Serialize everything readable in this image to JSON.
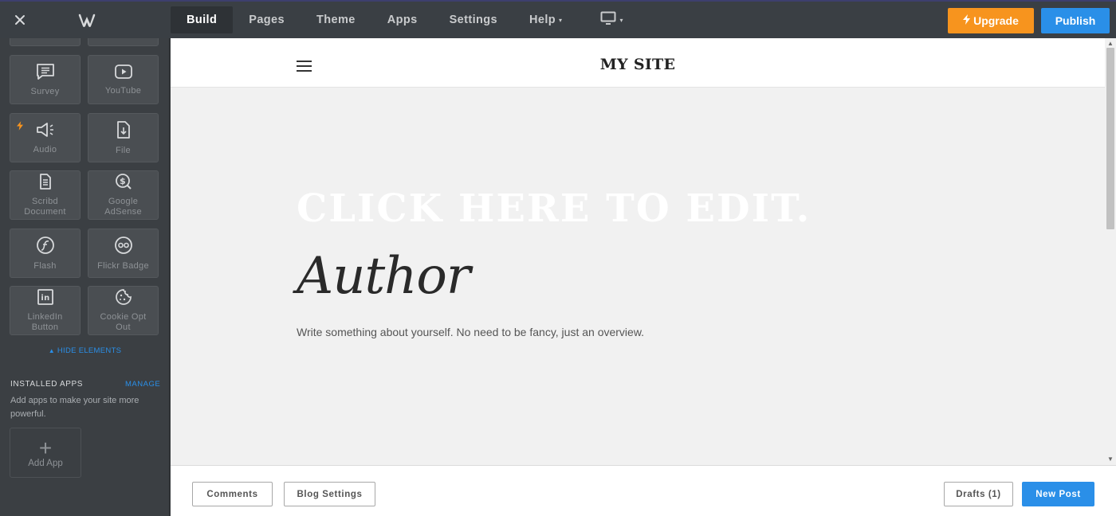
{
  "topbar": {
    "close_icon": "close-icon",
    "logo_icon": "weebly-logo-icon",
    "tabs": [
      {
        "label": "Build"
      },
      {
        "label": "Pages"
      },
      {
        "label": "Theme"
      },
      {
        "label": "Apps"
      },
      {
        "label": "Settings"
      },
      {
        "label": "Help"
      }
    ],
    "device_icon": "monitor-icon",
    "upgrade_label": "Upgrade",
    "publish_label": "Publish"
  },
  "sidebar": {
    "elements": [
      {
        "label": "Survey",
        "icon": "survey-icon"
      },
      {
        "label": "YouTube",
        "icon": "youtube-icon"
      },
      {
        "label": "Audio",
        "icon": "audio-icon",
        "premium": true
      },
      {
        "label": "File",
        "icon": "file-icon"
      },
      {
        "label": "Scribd Document",
        "icon": "scribd-icon"
      },
      {
        "label": "Google AdSense",
        "icon": "adsense-icon"
      },
      {
        "label": "Flash",
        "icon": "flash-icon"
      },
      {
        "label": "Flickr Badge",
        "icon": "flickr-icon"
      },
      {
        "label": "LinkedIn Button",
        "icon": "linkedin-icon"
      },
      {
        "label": "Cookie Opt Out",
        "icon": "cookie-icon"
      }
    ],
    "hide_elements_label": "HIDE ELEMENTS",
    "installed_apps_title": "INSTALLED APPS",
    "manage_label": "MANAGE",
    "installed_apps_desc": "Add apps to make your site more powerful.",
    "add_app_label": "Add App"
  },
  "canvas": {
    "site_title": "MY SITE",
    "headline": "CLICK HERE TO EDIT.",
    "author": "Author",
    "about": "Write something about yourself. No need to be fancy, just an overview."
  },
  "bottombar": {
    "comments_label": "Comments",
    "blog_settings_label": "Blog Settings",
    "drafts_label": "Drafts (1)",
    "new_post_label": "New Post"
  },
  "colors": {
    "accent_blue": "#2a8fe8",
    "upgrade_orange": "#f7941e",
    "sidebar_bg": "#3b3f43"
  }
}
